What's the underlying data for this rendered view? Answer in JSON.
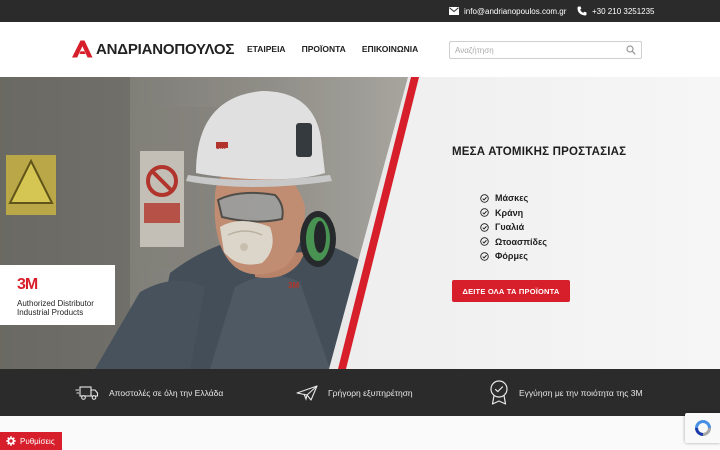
{
  "topbar": {
    "email": "info@andrianopoulos.com.gr",
    "phone": "+30 210 3251235"
  },
  "header": {
    "logo_text": "ΑΝΔΡΙΑΝΟΠΟΥΛΟΣ",
    "nav": [
      "ΕΤΑΙΡΕΙΑ",
      "ΠΡΟΪΟΝΤΑ",
      "ΕΠΙΚΟΙΝΩΝΙΑ"
    ],
    "search_placeholder": "Αναζήτηση"
  },
  "hero": {
    "title": "ΜΕΣΑ ΑΤΟΜΙΚΗΣ ΠΡΟΣΤΑΣΙΑΣ",
    "items": [
      "Μάσκες",
      "Κράνη",
      "Γυαλιά",
      "Ωτοασπίδες",
      "Φόρμες"
    ],
    "cta_label": "ΔΕΙΤΕ ΟΛΑ ΤΑ ΠΡΟΪΟΝΤΑ",
    "badge": {
      "brand": "3M",
      "line1": "Authorized Distributor",
      "line2": "Industrial Products"
    }
  },
  "features": [
    {
      "label": "Αποστολές σε όλη την Ελλάδα",
      "icon": "delivery-truck-icon"
    },
    {
      "label": "Γρήγορη εξυπηρέτηση",
      "icon": "paper-plane-icon"
    },
    {
      "label": "Εγγύηση με την ποιότητα της 3M",
      "icon": "award-badge-icon"
    }
  ],
  "cookie_settings": {
    "label": "Ρυθμίσεις"
  },
  "colors": {
    "brand_red": "#d71f2b",
    "dark_bar": "#2b2b2b",
    "helmet_white": "#f4f4f4",
    "vest_gray": "#4a5560"
  }
}
